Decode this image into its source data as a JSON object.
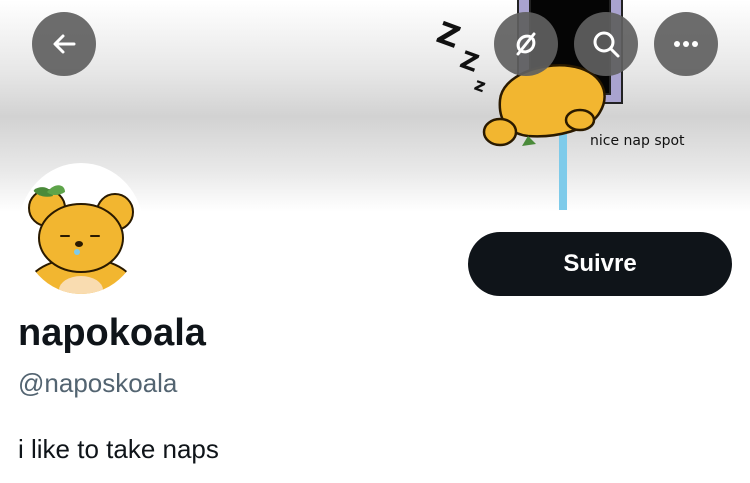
{
  "profile": {
    "display_name": "napokoala",
    "handle": "@naposkoala",
    "bio": "i like to take naps"
  },
  "actions": {
    "follow_label": "Suivre"
  },
  "banner": {
    "caption": "nice nap spot",
    "zzz": "Z Z z"
  },
  "icons": {
    "back": "arrow-left-icon",
    "translate": "no-wifi-icon",
    "search": "search-icon",
    "more": "more-horizontal-icon"
  },
  "colors": {
    "follow_button": "#0f1419",
    "handle_text": "#536471",
    "koala_yellow": "#f2b630"
  }
}
